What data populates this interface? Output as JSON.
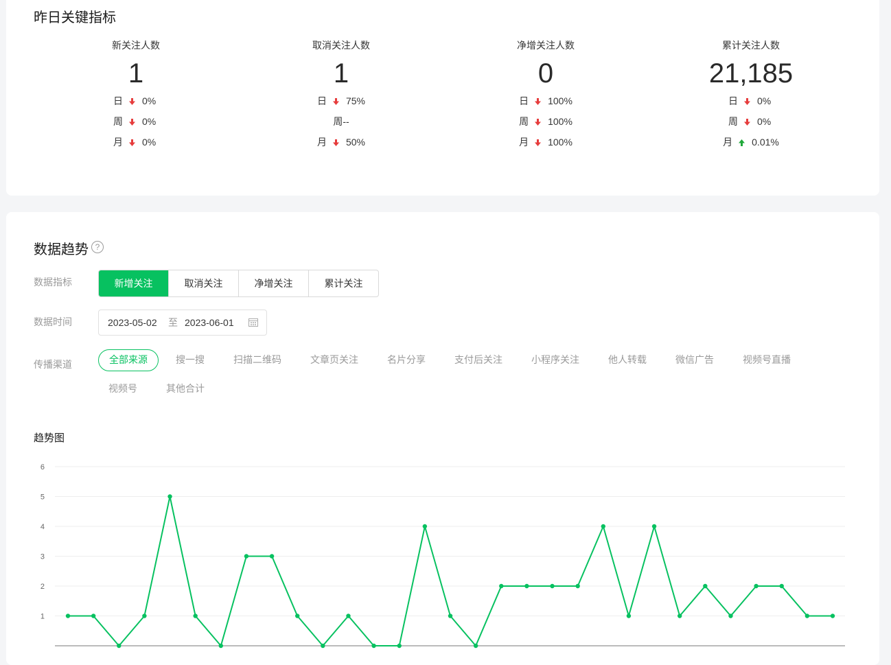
{
  "kpi": {
    "title": "昨日关键指标",
    "items": [
      {
        "label": "新关注人数",
        "value": "1",
        "rows": [
          {
            "period": "日",
            "dir": "down",
            "text": "0%"
          },
          {
            "period": "周",
            "dir": "down",
            "text": "0%"
          },
          {
            "period": "月",
            "dir": "down",
            "text": "0%"
          }
        ]
      },
      {
        "label": "取消关注人数",
        "value": "1",
        "rows": [
          {
            "period": "日",
            "dir": "down",
            "text": "75%"
          },
          {
            "period": "周",
            "dir": "none",
            "text": "--"
          },
          {
            "period": "月",
            "dir": "down",
            "text": "50%"
          }
        ]
      },
      {
        "label": "净增关注人数",
        "value": "0",
        "rows": [
          {
            "period": "日",
            "dir": "down",
            "text": "100%"
          },
          {
            "period": "周",
            "dir": "down",
            "text": "100%"
          },
          {
            "period": "月",
            "dir": "down",
            "text": "100%"
          }
        ]
      },
      {
        "label": "累计关注人数",
        "value": "21,185",
        "rows": [
          {
            "period": "日",
            "dir": "down",
            "text": "0%"
          },
          {
            "period": "周",
            "dir": "down",
            "text": "0%"
          },
          {
            "period": "月",
            "dir": "up",
            "text": "0.01%"
          }
        ]
      }
    ]
  },
  "trend": {
    "title": "数据趋势",
    "help_icon": "question-circle-icon",
    "metric_label": "数据指标",
    "metrics": [
      "新增关注",
      "取消关注",
      "净增关注",
      "累计关注"
    ],
    "active_metric": "新增关注",
    "time_label": "数据时间",
    "date_start": "2023-05-02",
    "date_sep": "至",
    "date_end": "2023-06-01",
    "calendar_icon": "calendar-icon",
    "channel_label": "传播渠道",
    "channels": [
      "全部来源",
      "搜一搜",
      "扫描二维码",
      "文章页关注",
      "名片分享",
      "支付后关注",
      "小程序关注",
      "他人转载",
      "微信广告",
      "视频号直播",
      "视频号",
      "其他合计"
    ],
    "active_channel": "全部来源",
    "chart_title": "趋势图"
  },
  "colors": {
    "accent": "#07c160",
    "down_arrow": "#e63c3c",
    "up_arrow": "#1fa83a",
    "grid": "#eeeeee",
    "axis": "#bbbbbb"
  },
  "chart_data": {
    "type": "line",
    "title": "趋势图",
    "series": [
      {
        "values": [
          1,
          1,
          0,
          1,
          5,
          1,
          0,
          3,
          3,
          1,
          0,
          1,
          0,
          0,
          4,
          1,
          0,
          2,
          2,
          2,
          2,
          4,
          1,
          4,
          1,
          2,
          1,
          2,
          2,
          1,
          1
        ]
      }
    ],
    "ylim": [
      0,
      6
    ],
    "yticks": [
      1,
      2,
      3,
      4,
      5,
      6
    ],
    "grid": true,
    "legend": "none"
  }
}
